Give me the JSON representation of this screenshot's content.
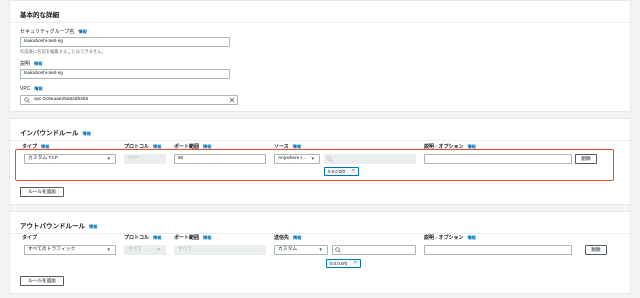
{
  "basic": {
    "title": "基本的な詳細",
    "sg_name_label": "セキュリティグループ名",
    "sg_name_info": "情報",
    "sg_name_value": "tsukuboshi-test-sg",
    "sg_name_hint": "作成後に名前を編集することはできません。",
    "desc_label": "説明",
    "desc_info": "情報",
    "desc_value": "tsukuboshi-test-sg",
    "vpc_label": "VPC",
    "vpc_info": "情報",
    "vpc_value": "vpc-0c6eaae25a62d5456"
  },
  "inbound": {
    "title": "インバウンドルール",
    "info": "情報",
    "headers": {
      "type": "タイプ",
      "type_info": "情報",
      "protocol": "プロトコル",
      "protocol_info": "情報",
      "port": "ポート範囲",
      "port_info": "情報",
      "source": "ソース",
      "source_info": "情報",
      "desc": "説明 - オプション",
      "desc_info": "情報"
    },
    "rule": {
      "type": "カスタム TCP",
      "protocol": "TCP",
      "port": "80",
      "source": "Anywhere-I...",
      "token": "0.0.0.0/0",
      "delete": "削除"
    },
    "add_rule": "ルールを追加"
  },
  "outbound": {
    "title": "アウトバウンドルール",
    "info": "情報",
    "headers": {
      "type": "タイプ",
      "protocol": "プロトコル",
      "protocol_info": "情報",
      "port": "ポート範囲",
      "port_info": "情報",
      "dest": "送信先",
      "dest_info": "情報",
      "desc": "説明 - オプション",
      "desc_info": "情報"
    },
    "rule": {
      "type": "すべてのトラフィック",
      "protocol": "すべて",
      "port": "すべて",
      "dest": "カスタム",
      "token": "0.0.0.0/0",
      "delete": "削除"
    },
    "add_rule": "ルールを追加"
  },
  "colors": {
    "highlight": "#e0502e",
    "link": "#0073bb",
    "token_border": "#0073bb"
  },
  "icons": [
    "search-icon",
    "clear-icon",
    "caret-down-icon",
    "token-remove-icon"
  ]
}
